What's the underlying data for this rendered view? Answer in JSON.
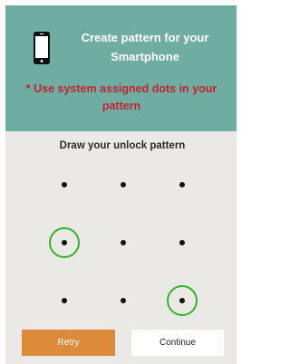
{
  "header": {
    "title": "Create pattern for your Smartphone",
    "note": "* Use system assigned dots in your pattern",
    "device_icon": "smartphone-icon",
    "background_color": "#6fada3",
    "note_color": "#c0242f"
  },
  "pattern": {
    "title": "Draw your unlock pattern",
    "selected_color": "#2db52d",
    "dots": [
      {
        "row": 1,
        "col": 1,
        "selected": false
      },
      {
        "row": 1,
        "col": 2,
        "selected": false
      },
      {
        "row": 1,
        "col": 3,
        "selected": false
      },
      {
        "row": 2,
        "col": 1,
        "selected": true
      },
      {
        "row": 2,
        "col": 2,
        "selected": false
      },
      {
        "row": 2,
        "col": 3,
        "selected": false
      },
      {
        "row": 3,
        "col": 1,
        "selected": false
      },
      {
        "row": 3,
        "col": 2,
        "selected": false
      },
      {
        "row": 3,
        "col": 3,
        "selected": true
      }
    ]
  },
  "actions": {
    "retry_label": "Retry",
    "continue_label": "Continue",
    "retry_color": "#dd8a3b"
  }
}
